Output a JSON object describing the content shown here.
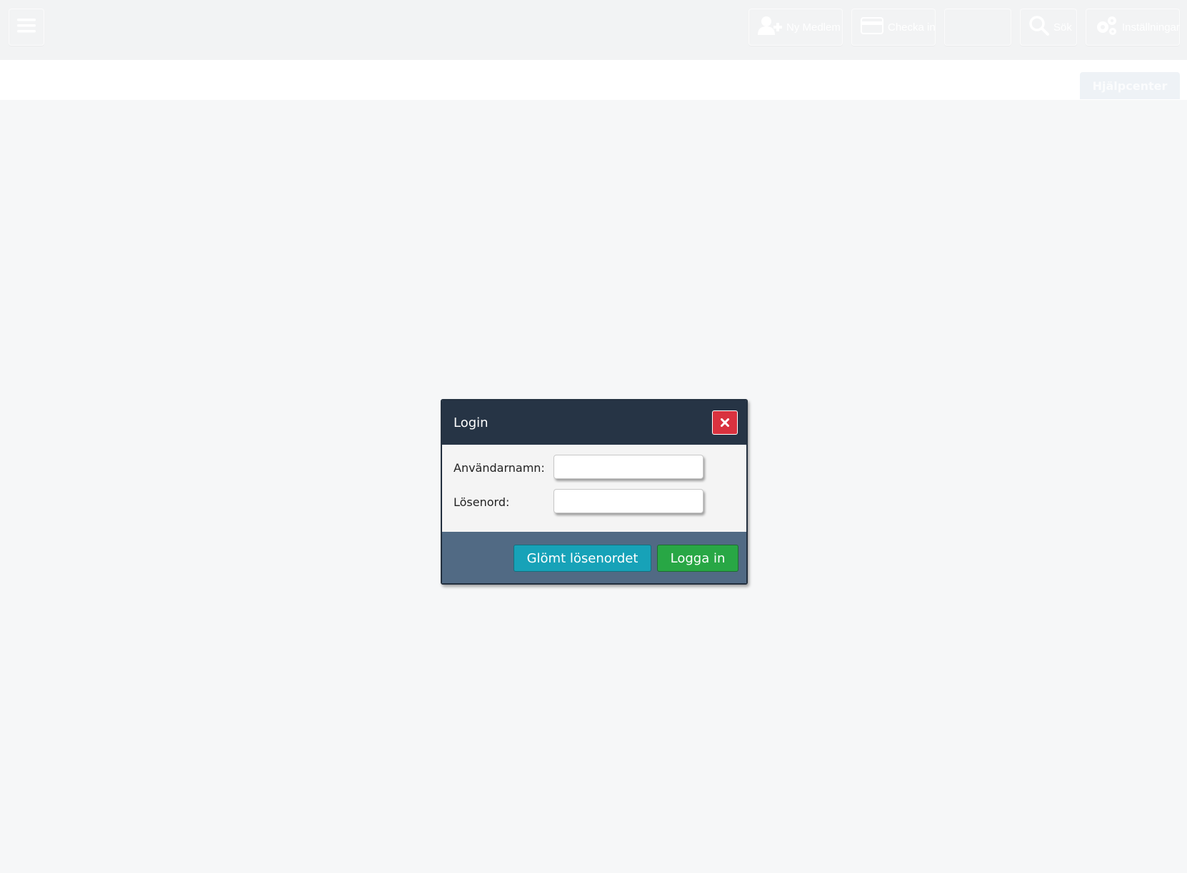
{
  "topbar": {
    "menu_icon": "hamburger-menu-icon",
    "items": [
      {
        "label": "Ny Medlem",
        "icon": "add-user-icon"
      },
      {
        "label": "Checka in",
        "icon": "credit-card-icon"
      },
      {
        "label": "",
        "icon": ""
      },
      {
        "label": "Sök",
        "icon": "search-icon"
      },
      {
        "label": "Inställningar",
        "icon": "gears-icon"
      }
    ]
  },
  "subbar": {
    "help_label": "Hjälpcenter"
  },
  "dialog": {
    "title": "Login",
    "close_icon": "close-icon",
    "username_label": "Användarnamn:",
    "username_value": "",
    "password_label": "Lösenord:",
    "password_value": "",
    "forgot_label": "Glömt lösenordet",
    "login_label": "Logga in"
  },
  "colors": {
    "header": "#263445",
    "footer": "#516a84",
    "close": "#d9323f",
    "forgot": "#17a2b8",
    "login": "#28a745"
  }
}
